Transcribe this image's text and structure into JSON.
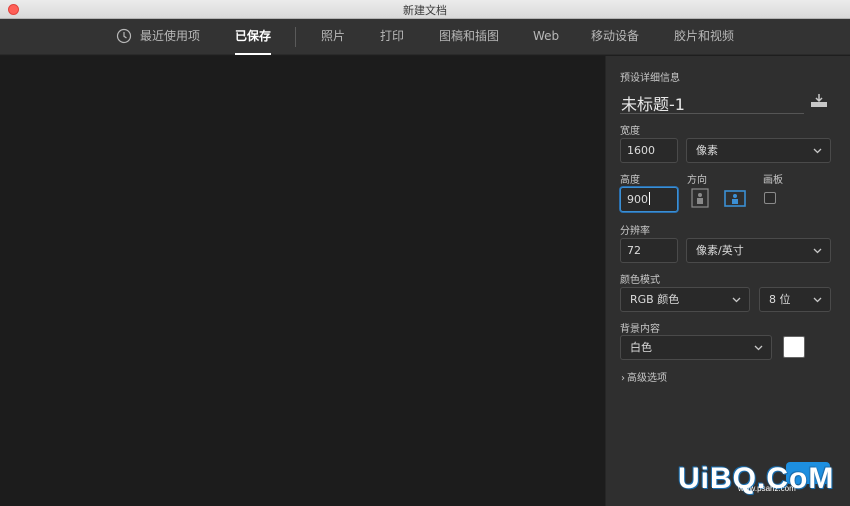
{
  "window": {
    "title": "新建文档"
  },
  "tabs": [
    {
      "label": "最近使用项"
    },
    {
      "label": "已保存"
    },
    {
      "label": "照片"
    },
    {
      "label": "打印"
    },
    {
      "label": "图稿和插图"
    },
    {
      "label": "Web"
    },
    {
      "label": "移动设备"
    },
    {
      "label": "胶片和视频"
    }
  ],
  "active_tab": "已保存",
  "preset": {
    "section_label": "预设详细信息",
    "title": "未标题-1",
    "width_label": "宽度",
    "width_value": "1600",
    "width_unit": "像素",
    "height_label": "高度",
    "height_value": "900",
    "orientation_label": "方向",
    "orientation_selected": "landscape",
    "artboard_label": "画板",
    "artboard_checked": false,
    "resolution_label": "分辨率",
    "resolution_value": "72",
    "resolution_unit": "像素/英寸",
    "color_mode_label": "颜色模式",
    "color_mode_value": "RGB 颜色",
    "bit_depth_value": "8 位",
    "background_label": "背景内容",
    "background_value": "白色",
    "background_color": "#ffffff",
    "advanced_label": "高级选项"
  },
  "watermark": {
    "main": "UiBQ.CoM",
    "sub": "www.psahz.com"
  },
  "colors": {
    "accent": "#3b8fd4",
    "panel": "#2f2f2f",
    "canvas": "#1c1c1c",
    "close": "#ff5f57"
  }
}
